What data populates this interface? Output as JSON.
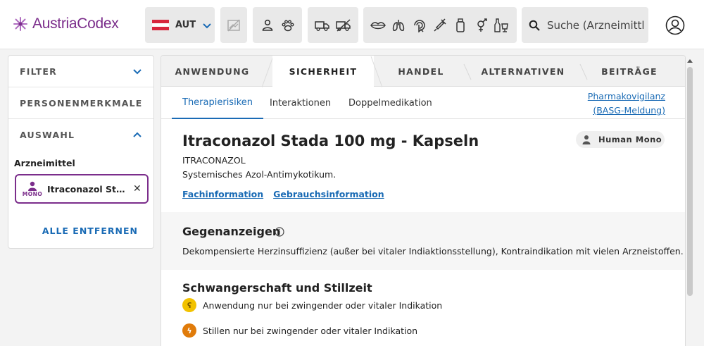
{
  "header": {
    "logo_text": "AustriaCodex",
    "country_code": "AUT",
    "search_placeholder": "Suche (Arzneimittl",
    "icons": [
      "no-image-icon",
      "person-icon",
      "paw-icon",
      "truck-icon",
      "crossed-truck-icon",
      "lips-icon",
      "lungs-icon",
      "touch-icon",
      "syringe-icon",
      "bottle-icon",
      "gender-icon",
      "drinks-icon",
      "search-icon",
      "user-avatar-icon"
    ]
  },
  "sidebar": {
    "filter_label": "FILTER",
    "personal_label": "PERSONENMERKMALE",
    "selection_label": "AUSWAHL",
    "medicine_label": "Arzneimittel",
    "chip_tag": "MONO",
    "chip_name": "Itraconazol St…",
    "remove_all": "ALLE ENTFERNEN"
  },
  "tabs": {
    "items": [
      "ANWENDUNG",
      "SICHERHEIT",
      "HANDEL",
      "ALTERNATIVEN",
      "BEITRÄGE"
    ],
    "active": "SICHERHEIT"
  },
  "subtabs": {
    "items": [
      "Therapierisiken",
      "Interaktionen",
      "Doppelmedikation"
    ],
    "active": "Therapierisiken",
    "pharma_line1": "Pharmakovigilanz",
    "pharma_line2": "(BASG-Meldung)"
  },
  "product": {
    "title": "Itraconazol Stada 100 mg - Kapseln",
    "badge": "Human Mono",
    "ingredient": "ITRACONAZOL",
    "description": "Systemisches Azol-Antimykotikum.",
    "link_fachinfo": "Fachinformation",
    "link_gebrauch": "Gebrauchsinformation"
  },
  "contraindications": {
    "heading": "Gegenanzeigen",
    "text": "Dekompensierte Herzinsuffizienz (außer bei vitaler Indiaktionsstellung), Kontraindikation mit vielen Arzneistoffen."
  },
  "pregnancy": {
    "heading": "Schwangerschaft und Stillzeit",
    "item1": "Anwendung nur bei zwingender oder vitaler Indikation",
    "item2": "Stillen nur bei zwingender oder vitaler Indikation"
  },
  "colors": {
    "brand": "#7b2d8b",
    "link": "#1a6bb5",
    "pregnancy_yellow": "#f2c200",
    "nursing_orange": "#e07b0a"
  }
}
